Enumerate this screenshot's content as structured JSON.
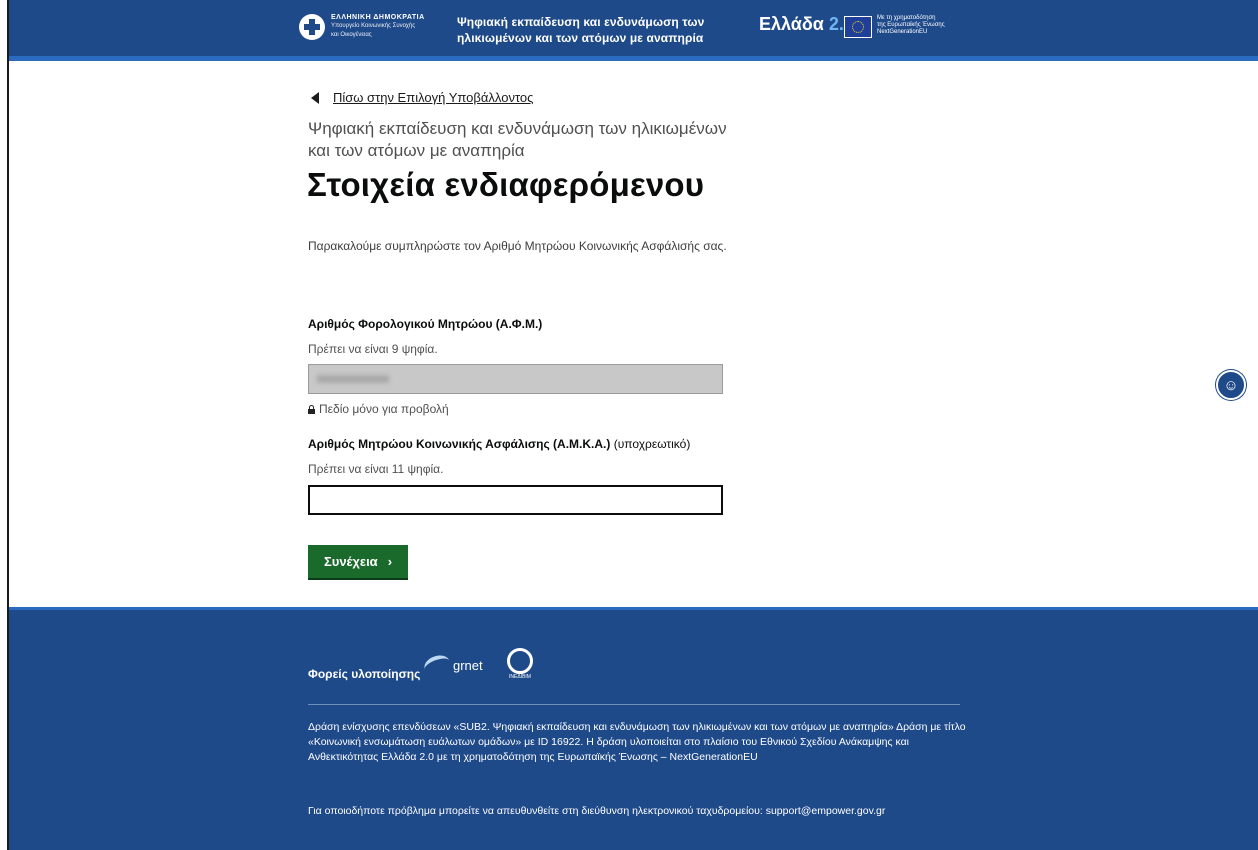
{
  "header": {
    "gov_line1": "ΕΛΛΗΝΙΚΗ ΔΗΜΟΚΡΑΤΙΑ",
    "gov_line2": "Υπουργείο Κοινωνικής Συνοχής",
    "gov_line3": "και Οικογένειας",
    "title_line1": "Ψηφιακή εκπαίδευση και ενδυνάμωση των",
    "title_line2": "ηλικιωμένων και των ατόμων με αναπηρία",
    "greece20": "Ελλάδα",
    "greece20_version": "2.0",
    "eu_line1": "Με τη χρηματοδότηση",
    "eu_line2": "της Ευρωπαϊκής Ένωσης",
    "eu_line3": "NextGenerationEU"
  },
  "main": {
    "back_link": "Πίσω στην Επιλογή Υποβάλλοντος",
    "caption": "Ψηφιακή εκπαίδευση και ενδυνάμωση των ηλικιωμένων και των ατόμων με αναπηρία",
    "heading": "Στοιχεία ενδιαφερόμενου",
    "intro": "Παρακαλούμε συμπληρώστε τον Αριθμό Μητρώου Κοινωνικής Ασφάλισής σας.",
    "afm": {
      "label": "Αριθμός Φορολογικού Μητρώου (Α.Φ.Μ.)",
      "hint": "Πρέπει να είναι 9 ψηφία.",
      "readonly_note": "Πεδίο μόνο για προβολή"
    },
    "amka": {
      "label": "Αριθμός Μητρώου Κοινωνικής Ασφάλισης (Α.Μ.Κ.Α.)",
      "required_note": "(υποχρεωτικό)",
      "hint": "Πρέπει να είναι 11 ψηφία.",
      "value": ""
    },
    "continue_button": "Συνέχεια",
    "continue_chevron": "›"
  },
  "accessibility_icon": "accessibility-icon",
  "footer": {
    "implementers_label": "Φορείς υλοποίησης",
    "grnet": "grnet",
    "inedivim": "INEΔΙΒΙΜ",
    "text": "Δράση ενίσχυσης επενδύσεων «SUB2. Ψηφιακή εκπαίδευση και ενδυνάμωση των ηλικιωμένων και των ατόμων με αναπηρία» Δράση με τίτλο «Κοινωνική ενσωμάτωση ευάλωτων ομάδων» με ID 16922. Η δράση υλοποιείται στο πλαίσιο του Εθνικού Σχεδίου Ανάκαμψης και Ανθεκτικότητας Ελλάδα 2.0 με τη χρηματοδότηση της Ευρωπαϊκής Ένωσης – NextGenerationEU",
    "contact": "Για οποιοδήποτε πρόβλημα μπορείτε να απευθυνθείτε στη διεύθυνση ηλεκτρονικού ταχυδρομείου: support@empower.gov.gr"
  },
  "colors": {
    "header_blue": "#1f4a8a",
    "button_green": "#1a6b2b"
  }
}
